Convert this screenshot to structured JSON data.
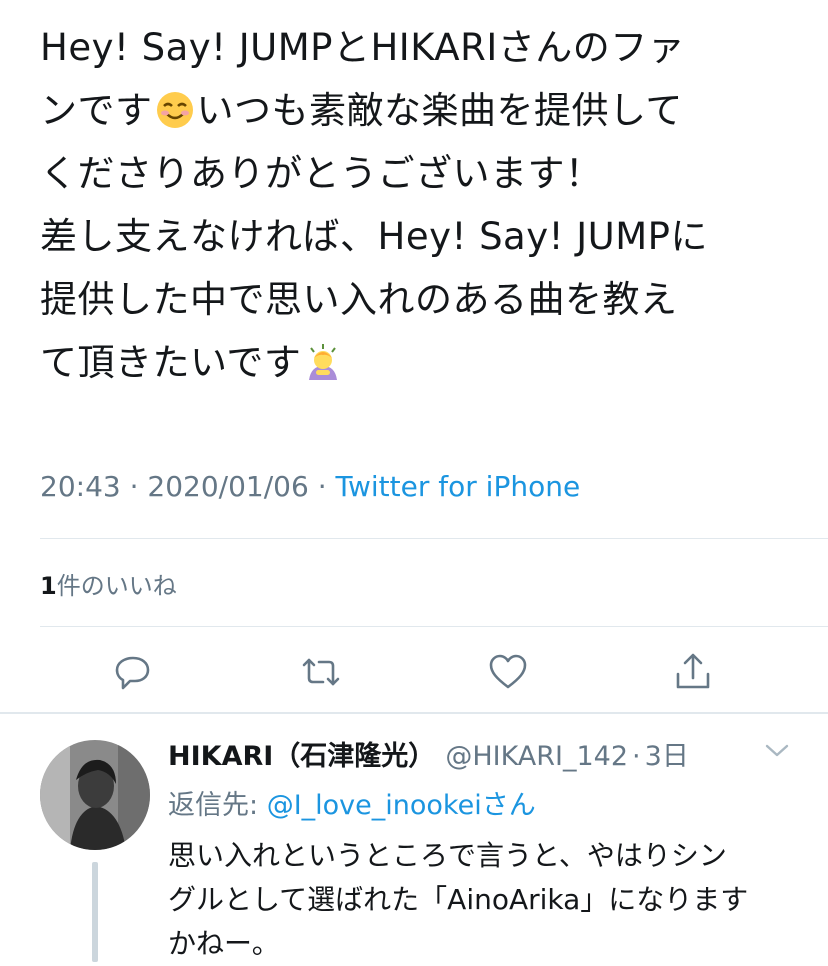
{
  "tweet": {
    "text_lines": [
      "Hey! Say! JUMPとHIKARIさんのファ",
      "ンです",
      "いつも素敵な楽曲を提供して",
      "くださりありがとうございます！",
      "差し支えなければ、Hey! Say! JUMPに",
      "提供した中で思い入れのある曲を教え",
      "て頂きたいです"
    ],
    "emoji_1": "smiling-face-emoji",
    "emoji_2": "person-bowing-emoji",
    "time": "20:43",
    "separator": "·",
    "date": "2020/01/06",
    "separator2": "·",
    "source": "Twitter for iPhone"
  },
  "likes": {
    "count": "1",
    "label": "件のいいね"
  },
  "actions": {
    "reply_icon": "reply-icon",
    "retweet_icon": "retweet-icon",
    "like_icon": "heart-icon",
    "share_icon": "share-icon"
  },
  "reply": {
    "name": "HIKARI（石津隆光）",
    "handle": "@HIKARI_142",
    "separator": "·",
    "time_ago": "3日",
    "reply_to_label": "返信先: ",
    "reply_to_mention": "@I_love_inookei",
    "reply_to_suffix": "さん",
    "text_lines": [
      "思い入れというところで言うと、やはりシン",
      "グルとして選ばれた「AinoArika」になります",
      "かねー。"
    ]
  },
  "colors": {
    "link": "#1b95e0",
    "secondary": "#657786",
    "text": "#14171a",
    "divider": "#e1e8ed"
  }
}
